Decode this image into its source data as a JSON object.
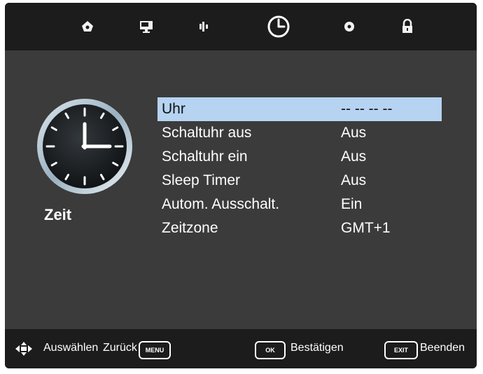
{
  "tabs": [
    {
      "icon": "picture-icon"
    },
    {
      "icon": "screen-icon"
    },
    {
      "icon": "sound-icon"
    },
    {
      "icon": "clock-icon",
      "active": true
    },
    {
      "icon": "setup-icon"
    },
    {
      "icon": "lock-icon"
    }
  ],
  "side": {
    "title": "Zeit",
    "icon": "clock-icon"
  },
  "menu": {
    "items": [
      {
        "label": "Uhr",
        "value": "-- -- -- --",
        "selected": true
      },
      {
        "label": "Schaltuhr aus",
        "value": "Aus"
      },
      {
        "label": "Schaltuhr ein",
        "value": "Aus"
      },
      {
        "label": "Sleep Timer",
        "value": "Aus"
      },
      {
        "label": "Autom. Ausschalt.",
        "value": "Ein"
      },
      {
        "label": "Zeitzone",
        "value": "GMT+1"
      }
    ]
  },
  "footer": {
    "select_label": "Auswählen",
    "back_label": "Zurück",
    "menu_key": "MENU",
    "ok_key": "OK",
    "confirm_label": "Bestätigen",
    "exit_key": "EXIT",
    "exit_label": "Beenden"
  },
  "colors": {
    "highlight": "#b6d3f2",
    "panel": "#3b3b3b",
    "bar": "#1c1c1c"
  }
}
